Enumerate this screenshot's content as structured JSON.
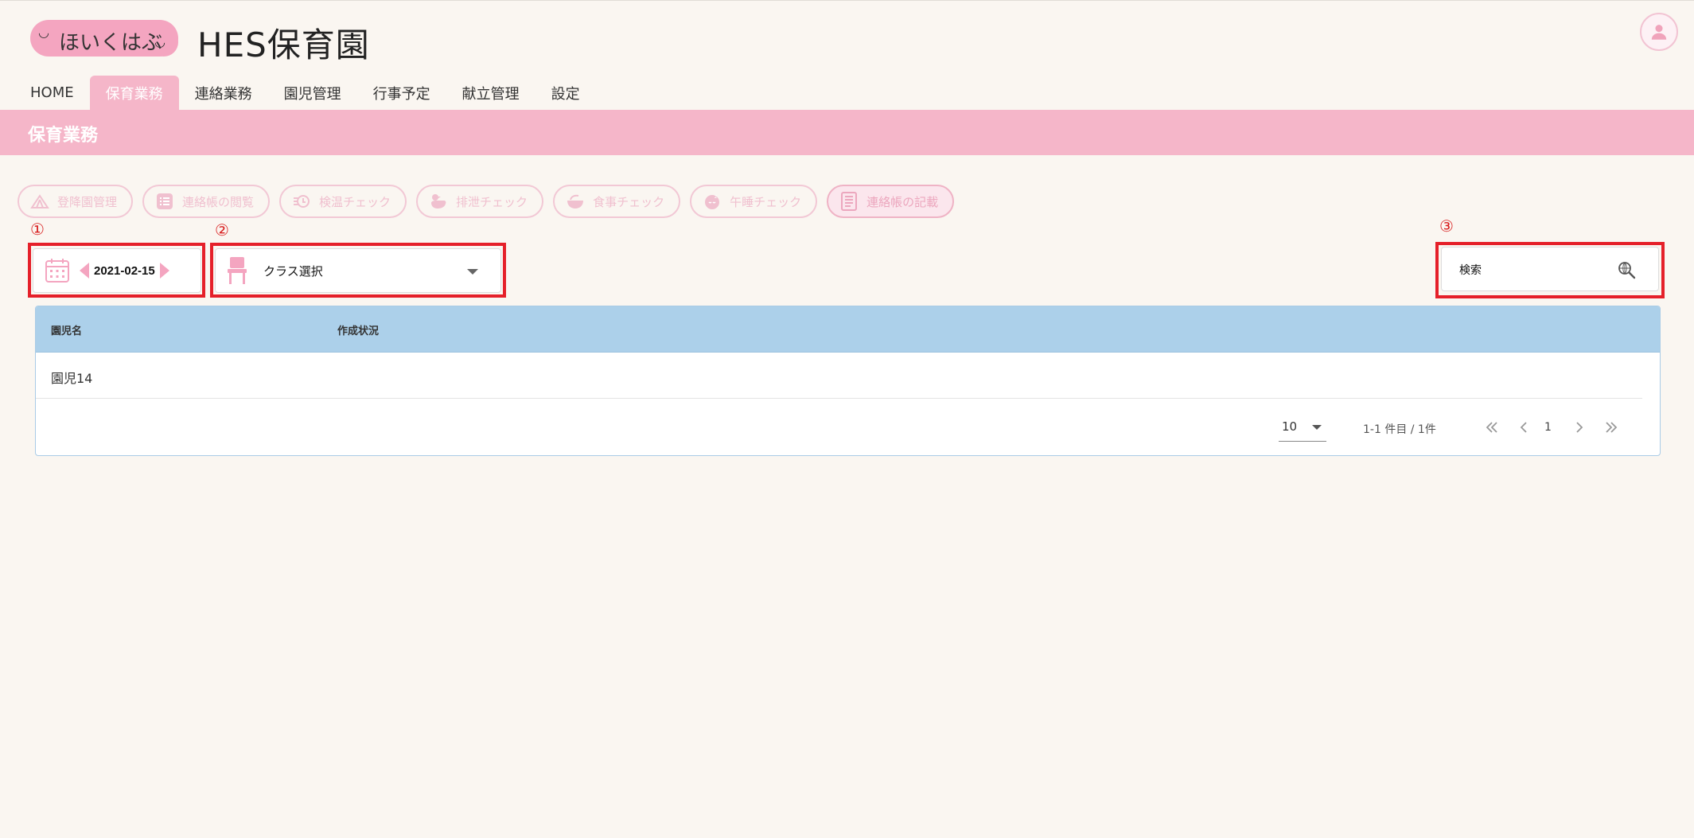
{
  "header": {
    "logo_text": "ほいくはぶ",
    "app_title": "HES保育園"
  },
  "nav": {
    "items": [
      {
        "label": "HOME"
      },
      {
        "label": "保育業務"
      },
      {
        "label": "連絡業務"
      },
      {
        "label": "園児管理"
      },
      {
        "label": "行事予定"
      },
      {
        "label": "献立管理"
      },
      {
        "label": "設定"
      }
    ],
    "active_index": 1
  },
  "banner": {
    "title": "保育業務"
  },
  "functions": [
    {
      "label": "登降園管理"
    },
    {
      "label": "連絡帳の閲覧"
    },
    {
      "label": "検温チェック"
    },
    {
      "label": "排泄チェック"
    },
    {
      "label": "食事チェック"
    },
    {
      "label": "午睡チェック"
    },
    {
      "label": "連絡帳の記載"
    }
  ],
  "annotations": [
    "①",
    "②",
    "③"
  ],
  "date_picker": {
    "value": "2021-02-15"
  },
  "class_select": {
    "value": "クラス選択"
  },
  "search": {
    "placeholder": "検索"
  },
  "table": {
    "columns": [
      "園児名",
      "作成状況"
    ],
    "rows": [
      {
        "name": "園児14",
        "status": ""
      }
    ]
  },
  "pagination": {
    "per_page": "10",
    "range": "1-1 件目 / 1件",
    "current_page": "1"
  },
  "colors": {
    "accent_pink": "#f5b6c9",
    "table_header_blue": "#acd0ea",
    "annotation_red": "#e5202a",
    "background": "#faf6f1"
  }
}
